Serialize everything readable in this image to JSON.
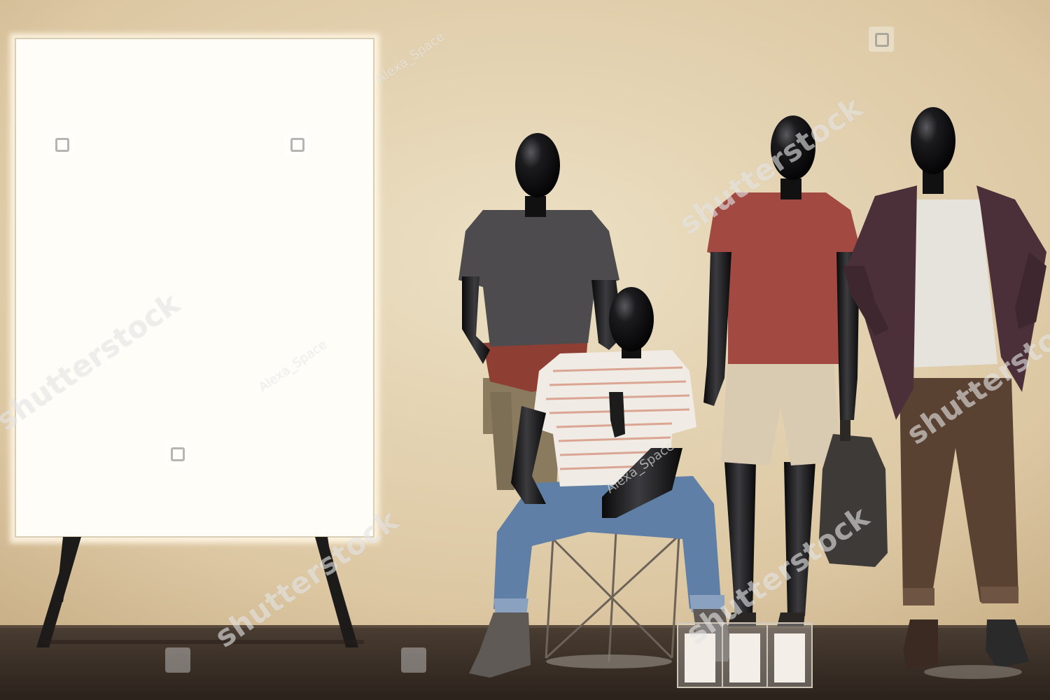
{
  "scene": {
    "description_colors": {
      "wall": "#e6d4b2",
      "floor": "#3a2f27",
      "lightbox": "#fffdf8"
    }
  },
  "watermarks": {
    "brand": "shutterstock",
    "author": "Alexa_Space"
  }
}
